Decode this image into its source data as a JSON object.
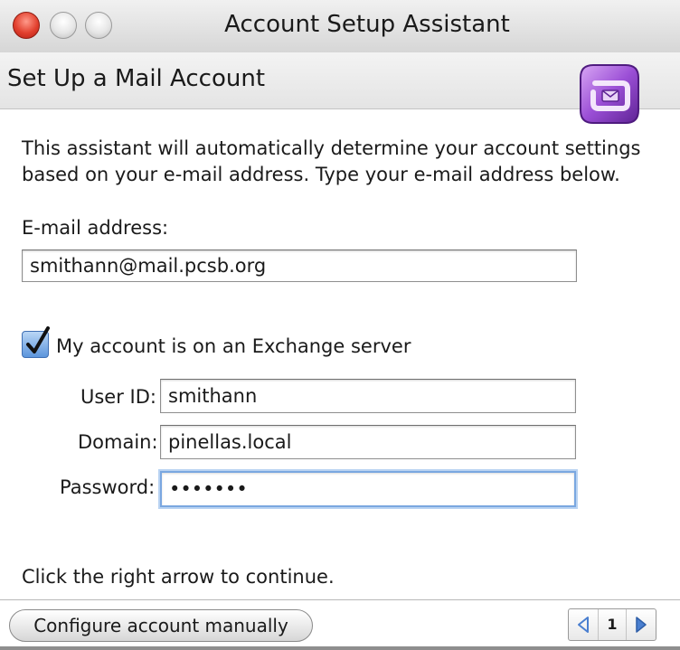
{
  "window": {
    "title": "Account Setup Assistant"
  },
  "header": {
    "title": "Set Up a Mail Account",
    "logo_icon": "entourage-logo-icon"
  },
  "intro": {
    "text": "This assistant will automatically determine your account settings based on your e-mail address. Type your e-mail address below."
  },
  "email": {
    "label": "E-mail address:",
    "value": "smithann@mail.pcsb.org"
  },
  "exchange": {
    "checkbox_label": "My account is on an Exchange server",
    "checked": true
  },
  "user_id": {
    "label": "User ID:",
    "value": "smithann"
  },
  "domain": {
    "label": "Domain:",
    "value": "pinellas.local"
  },
  "password": {
    "label": "Password:",
    "value": "•••••••"
  },
  "footer": {
    "hint": "Click the right arrow to continue.",
    "manual_button": "Configure account manually",
    "page_number": "1"
  },
  "colors": {
    "focus_ring": "#7aa7e0",
    "checkbox_blue": "#5c95dc",
    "pager_arrow": "#4a7fd0",
    "logo_purple": "#8e44c9"
  }
}
